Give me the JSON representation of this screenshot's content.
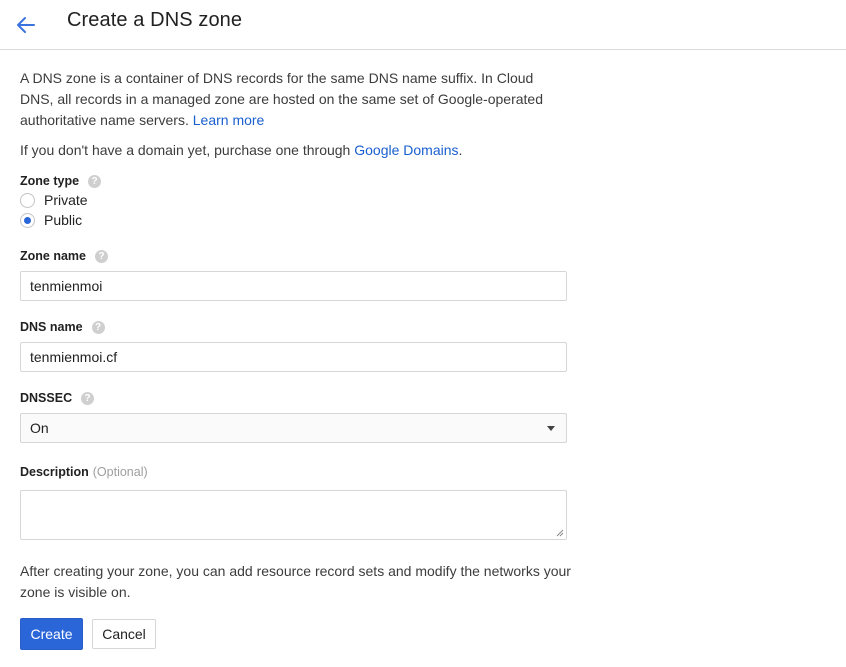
{
  "header": {
    "back_icon": "arrow-left-icon",
    "title": "Create a DNS zone"
  },
  "intro": {
    "text": "A DNS zone is a container of DNS records for the same DNS name suffix. In Cloud DNS, all records in a managed zone are hosted on the same set of Google-operated authoritative name servers. ",
    "learn_more": "Learn more",
    "domain_text": "If you don't have a domain yet, purchase one through ",
    "domain_link": "Google Domains",
    "domain_suffix": "."
  },
  "zone_type": {
    "label": "Zone type",
    "help_icon": "?",
    "options": [
      {
        "label": "Private",
        "checked": false
      },
      {
        "label": "Public",
        "checked": true
      }
    ]
  },
  "zone_name": {
    "label": "Zone name",
    "help_icon": "?",
    "value": "tenmienmoi"
  },
  "dns_name": {
    "label": "DNS name",
    "help_icon": "?",
    "value": "tenmienmoi.cf"
  },
  "dnssec": {
    "label": "DNSSEC",
    "help_icon": "?",
    "selected": "On"
  },
  "description": {
    "label": "Description",
    "optional": "(Optional)",
    "value": ""
  },
  "outro": "After creating your zone, you can add resource record sets and modify the networks your zone is visible on.",
  "actions": {
    "create": "Create",
    "cancel": "Cancel"
  },
  "colors": {
    "accent": "#2b66d8",
    "link": "#1a5fd0"
  }
}
